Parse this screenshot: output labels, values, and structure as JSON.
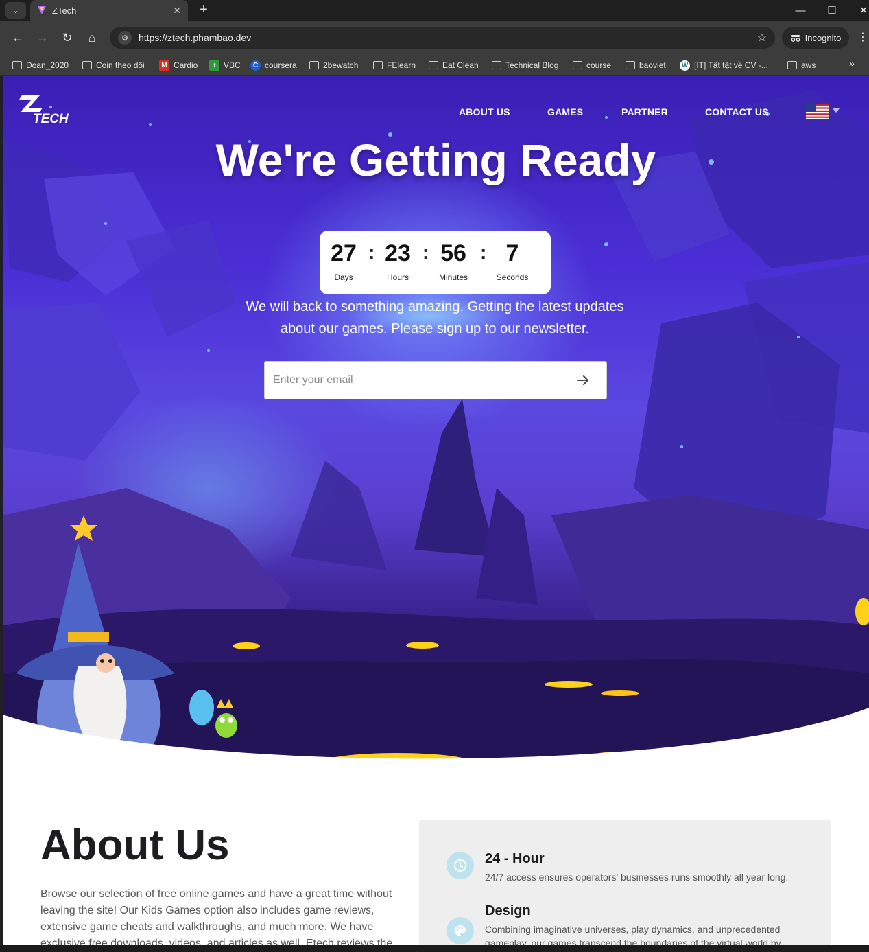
{
  "browser": {
    "tab": {
      "title": "ZTech",
      "close_glyph": "✕"
    },
    "new_tab_glyph": "+",
    "url": "https://ztech.phambao.dev",
    "incognito_label": "Incognito",
    "bookmarks": [
      {
        "label": "Doan_2020",
        "icon": "folder-icon"
      },
      {
        "label": "Coin theo dõi",
        "icon": "folder-icon"
      },
      {
        "label": "Cardio",
        "icon": "gmail-icon"
      },
      {
        "label": "VBC",
        "icon": "plus-favicon"
      },
      {
        "label": "coursera",
        "icon": "coursera-icon"
      },
      {
        "label": "2bewatch",
        "icon": "folder-icon"
      },
      {
        "label": "FElearn",
        "icon": "folder-icon"
      },
      {
        "label": "Eat Clean",
        "icon": "folder-icon"
      },
      {
        "label": "Technical Blog",
        "icon": "folder-icon"
      },
      {
        "label": "course",
        "icon": "folder-icon"
      },
      {
        "label": "baoviet",
        "icon": "folder-icon"
      },
      {
        "label": "[IT] Tất tật về CV -...",
        "icon": "wordpress-icon"
      },
      {
        "label": "aws",
        "icon": "folder-icon"
      }
    ]
  },
  "site": {
    "nav": {
      "about": "ABOUT US",
      "games": "GAMES",
      "partner": "PARTNER",
      "contact": "CONTACT US"
    },
    "hero": {
      "title": "We're Getting Ready",
      "countdown": {
        "days": "27",
        "days_label": "Days",
        "hours": "23",
        "hours_label": "Hours",
        "minutes": "56",
        "minutes_label": "Minutes",
        "seconds": "7",
        "seconds_label": "Seconds",
        "separator": ":"
      },
      "subtitle_line1": "We will back to something amazing. Getting the latest updates",
      "subtitle_line2": "about our games. Please sign up to our newsletter.",
      "email_placeholder": "Enter your email"
    },
    "about": {
      "title": "About Us",
      "text": "Browse our selection of free online games and have a great time without leaving the site! Our Kids Games option also includes game reviews, extensive game cheats and walkthroughs, and much more. We have exclusive free downloads, videos, and articles as well. Etech reviews the",
      "features": [
        {
          "icon": "clock-icon",
          "title": "24 - Hour",
          "desc": "24/7 access ensures operators' businesses runs smoothly all year long."
        },
        {
          "icon": "palette-icon",
          "title": "Design",
          "desc": "Combining imaginative universes, play dynamics, and unprecedented gameplay, our games transcend the boundaries of the virtual world by"
        }
      ]
    }
  },
  "colors": {
    "hero_top": "#3a1fb5",
    "hero_bottom": "#261462",
    "lava": "#ffd21a",
    "feature_icon_bg": "#bfe3ee"
  }
}
